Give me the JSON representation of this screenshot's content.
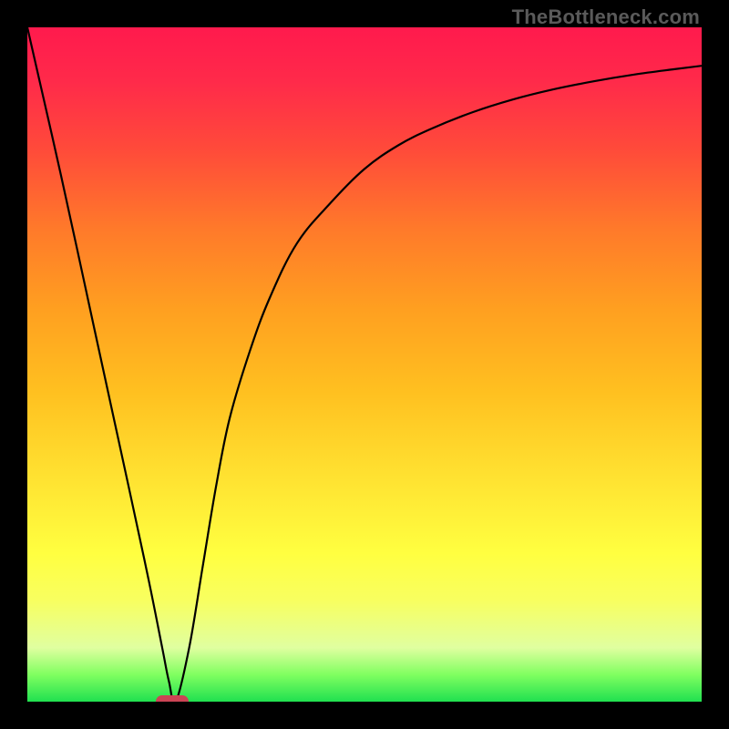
{
  "watermark": "TheBottleneck.com",
  "chart_data": {
    "type": "line",
    "title": "",
    "xlabel": "",
    "ylabel": "",
    "xlim": [
      0,
      100
    ],
    "ylim": [
      0,
      100
    ],
    "grid": false,
    "legend": false,
    "gradient_direction": "vertical",
    "gradient_stops": [
      {
        "pos": 0.0,
        "color": "#ff1a4d"
      },
      {
        "pos": 0.3,
        "color": "#ff7a2a"
      },
      {
        "pos": 0.6,
        "color": "#ffe030"
      },
      {
        "pos": 0.78,
        "color": "#ffff40"
      },
      {
        "pos": 1.0,
        "color": "#20e050"
      }
    ],
    "series": [
      {
        "name": "bottleneck-curve",
        "x": [
          0,
          5,
          10,
          15,
          18,
          20,
          21,
          22,
          24,
          26,
          28,
          30,
          33,
          36,
          40,
          45,
          50,
          55,
          60,
          66,
          72,
          78,
          84,
          90,
          96,
          100
        ],
        "y": [
          100,
          78,
          55,
          32,
          18,
          8,
          3,
          0,
          8,
          20,
          32,
          42,
          52,
          60,
          68,
          74,
          79,
          82.5,
          85,
          87.4,
          89.3,
          90.8,
          92,
          93,
          93.8,
          94.3
        ]
      }
    ],
    "marker": {
      "x": 21.5,
      "y": 0,
      "width_pct": 4.8,
      "height_pct": 1.9,
      "color": "#cc4455"
    }
  }
}
